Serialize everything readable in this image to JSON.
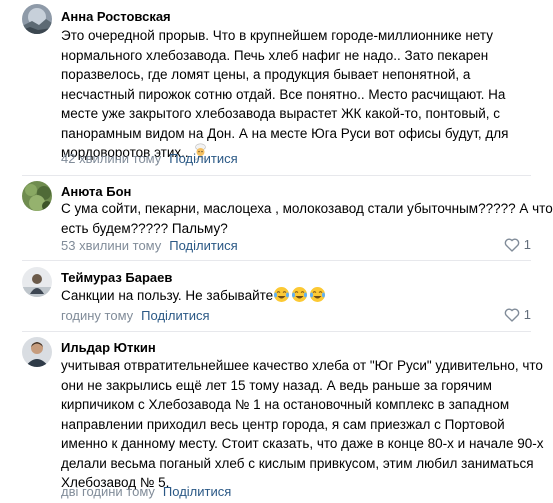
{
  "comments": [
    {
      "author": "Анна Ростовская",
      "lines": [
        "Это очередной прорыв. Что в крупнейшем городе-миллионнике нету",
        "нормального хлебозавода. Печь хлеб нафиг не надо.. Зато пекарен",
        "поразвелось, где ломят цены, а продукция бывает непонятной, а",
        "несчастный пирожок сотню отдай. Все понятно.. Место расчищают. На",
        "месте уже закрытого хлебозавода вырастет ЖК какой-то, понтовый, с",
        "панорамным видом на Дон. А на месте Юга Руси вот офисы будут, для",
        "мордоворотов этих.. "
      ],
      "time": "42 хвилини тому",
      "share": "Поділитися",
      "likes": ""
    },
    {
      "author": "Анюта Бон",
      "lines": [
        "С ума сойти, пекарни, маслоцеха , молокозавод стали убыточным????? А что",
        "есть будем????? Пальму?"
      ],
      "time": "53 хвилини тому",
      "share": "Поділитися",
      "likes": "1"
    },
    {
      "author": "Теймураз Бараев",
      "lines": [
        "Санкции на пользу. Не забывайте"
      ],
      "time": "годину тому",
      "share": "Поділитися",
      "likes": "1"
    },
    {
      "author": "Ильдар Юткин",
      "lines": [
        "учитывая отвратительнейшее качество хлеба от \"Юг Руси\" удивительно, что",
        "они не закрылись ещё лет 15 тому назад. А ведь раньше за горячим",
        "кирпичиком с Хлебозавода № 1 на остановочный комплекс в западном",
        "направлении приходил весь центр города, я сам приезжал с Портовой",
        "именно к данному месту. Стоит сказать, что даже в конце 80-х и начале 90-х",
        "делали весьма поганый хлеб с кислым привкусом, этим любил заниматься",
        "Хлебозавод № 5."
      ],
      "time": "дві години тому",
      "share": "Поділитися",
      "likes": ""
    }
  ],
  "colors": {
    "link": "#2a5885",
    "meta": "#818c99",
    "divider": "#e7e8ec"
  },
  "icons": {
    "like": "heart-outline-icon",
    "emoji_1": "man-cook-emoji",
    "emoji_3": "tears-of-joy-emoji"
  }
}
